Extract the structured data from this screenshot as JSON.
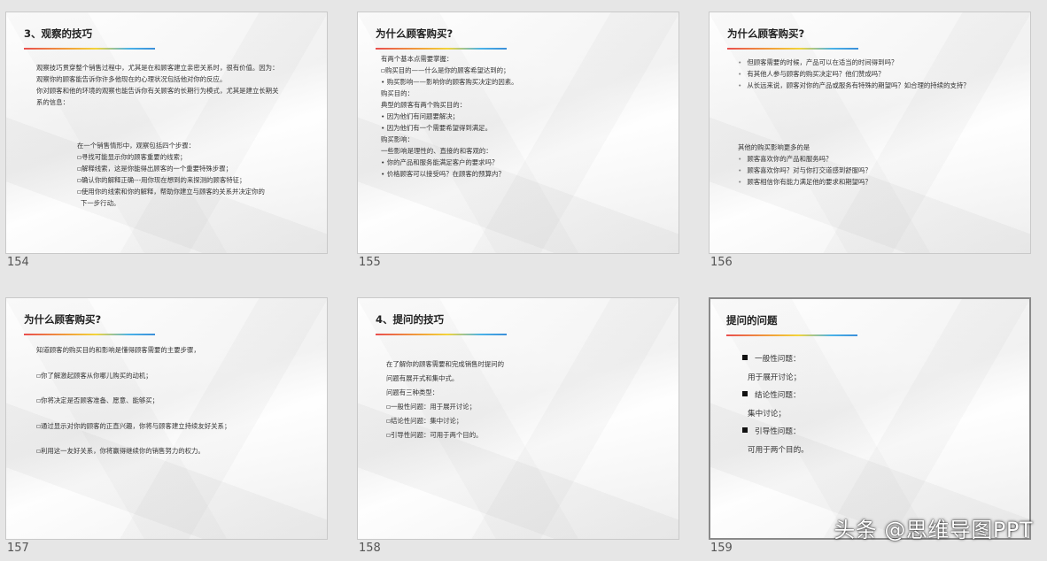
{
  "slides": [
    {
      "number": "154",
      "title": "3、观察的技巧",
      "block1": [
        "观察技巧贯穿整个销售过程中，尤其是在和顾客建立亲密关系时，很有价值。因为：",
        "观察你的顾客能告诉你许多他现在的心理状况包括他对你的反应。",
        "你对顾客和他的环境的观察也能告诉你有关顾客的长期行为模式，尤其是建立长期关",
        "系的信息："
      ],
      "block2": [
        "在一个销售情形中，观察包括四个步骤：",
        "▫寻找可能显示你的顾客重要的线索；",
        "▫解释线索，这是你能得出顾客的一个重要特殊步骤；",
        "▫确认你的解释正确---用你现在想到的来探测的顾客特征；",
        "▫使用你的线索和你的解释，帮助你建立与顾客的关系并决定你的",
        "  下一步行动。"
      ]
    },
    {
      "number": "155",
      "title": "为什么顾客购买?",
      "lines": [
        "有两个基本点需要掌握：",
        "▫购买目的——什么是你的顾客希望达到的；",
        "•   购买影响——影响你的顾客购买决定的因素。",
        "购买目的：",
        "典型的顾客有两个购买目的：",
        "•   因为他们有问题要解决；",
        "•   因为他们有一个需要希望得到满足。",
        "购买影响：",
        "一些影响是理性的、直接的和客观的：",
        "•   你的产品和服务能满足客户的要求吗？",
        "•   价格顾客可以接受吗？在顾客的预算内？"
      ]
    },
    {
      "number": "156",
      "title": "为什么顾客购买?",
      "block1": [
        "但顾客需要的时候，产品可以在适当的时间得到吗？",
        "有其他人参与顾客的购买决定吗？他们赞成吗？",
        "从长远来说，顾客对你的产品或服务有特殊的期望吗？如合理的持续的支持？"
      ],
      "block2_head": "其他的购买影响更多的是",
      "block2": [
        "顾客喜欢你的产品和服务吗？",
        "顾客喜欢你吗？对与你打交道感到舒服吗？",
        "顾客相信你有能力满足他的要求和期望吗？"
      ]
    },
    {
      "number": "157",
      "title": "为什么顾客购买?",
      "lines": [
        "知道顾客的购买目的和影响是懂得顾客需要的主要步骤，",
        "▫你了解激起顾客从你哪儿购买的动机；",
        "▫你将决定是否顾客准备、愿意、能够买；",
        "▫通过显示对你的顾客的正直兴趣，你将与顾客建立持续友好关系；",
        "▫利用这一友好关系，你将赢得继续你的销售努力的权力。"
      ]
    },
    {
      "number": "158",
      "title": "4、提问的技巧",
      "lines": [
        "在了解你的顾客需要和完成销售时提问的",
        "问题有展开式和集中式。",
        "问题有三种类型：",
        "▫一般性问题：用于展开讨论；",
        "▫结论性问题：集中讨论；",
        "▫引导性问题：可用于两个目的。"
      ]
    },
    {
      "number": "159",
      "title": "提问的问题",
      "items": [
        {
          "head": "一般性问题：",
          "sub": "用于展开讨论；"
        },
        {
          "head": "结论性问题：",
          "sub": "集中讨论；"
        },
        {
          "head": "引导性问题：",
          "sub": "可用于两个目的。"
        }
      ]
    }
  ],
  "watermark": "头条 @思维导图PPT"
}
